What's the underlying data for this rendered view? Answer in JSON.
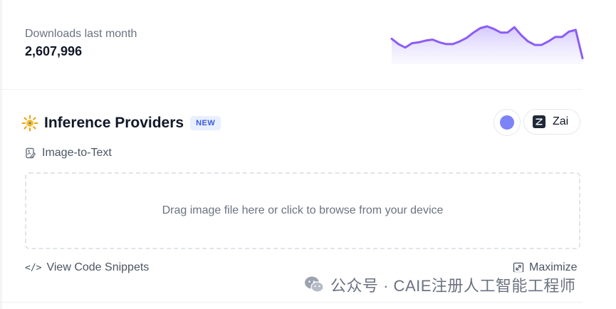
{
  "downloads": {
    "label": "Downloads last month",
    "count": "2,607,996",
    "sparkline": [
      52,
      46,
      42,
      47,
      48,
      50,
      51,
      48,
      46,
      46,
      49,
      53,
      59,
      64,
      66,
      63,
      59,
      59,
      65,
      56,
      49,
      45,
      45,
      49,
      54,
      54,
      60,
      62,
      30
    ],
    "accent_color": "#8b5cf6"
  },
  "inference": {
    "icon": "sun-sparkle-icon",
    "title": "Inference Providers",
    "badge": "NEW",
    "providers": [
      {
        "icon": "purple-dot-icon",
        "label": ""
      },
      {
        "icon": "zai-logo-icon",
        "label": "Zai"
      }
    ],
    "task": {
      "icon": "image-text-icon",
      "label": "Image-to-Text"
    },
    "dropzone_text": "Drag image file here or click to browse from your device",
    "view_code_label": "View Code Snippets",
    "maximize_label": "Maximize"
  },
  "watermark": {
    "icon": "wechat-icon",
    "text": "公众号 · CAIE注册人工智能工程师"
  }
}
